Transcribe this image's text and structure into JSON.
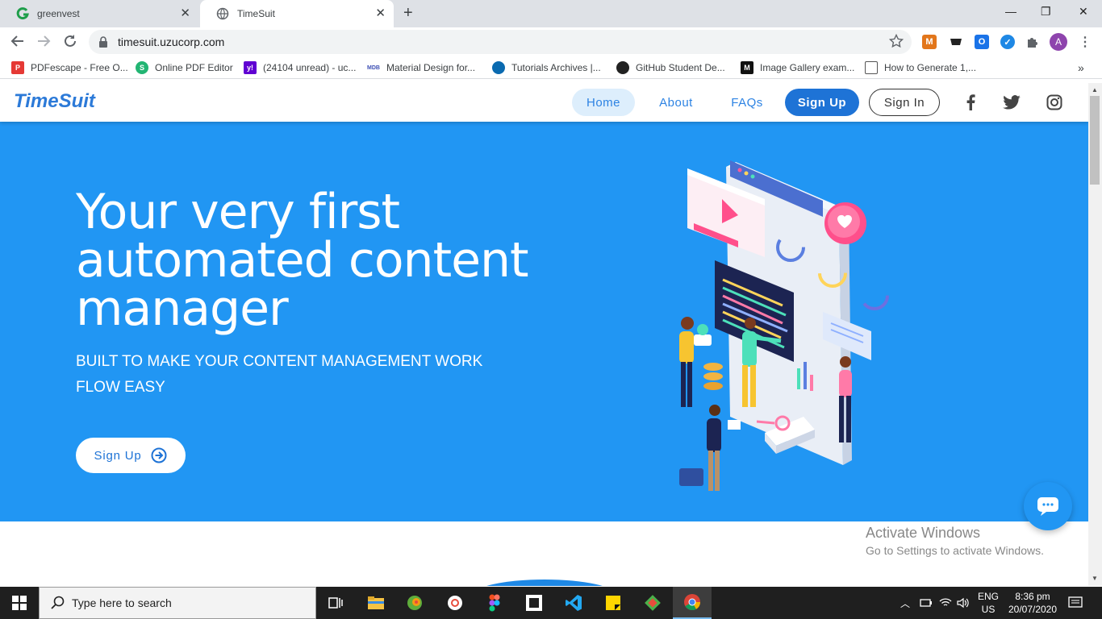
{
  "browser": {
    "tabs": [
      {
        "title": "greenvest"
      },
      {
        "title": "TimeSuit"
      }
    ],
    "url": "timesuit.uzucorp.com",
    "profile_initial": "A",
    "bookmarks": [
      {
        "label": "PDFescape - Free O..."
      },
      {
        "label": "Online PDF Editor"
      },
      {
        "label": "(24104 unread) - uc..."
      },
      {
        "label": "Material Design for..."
      },
      {
        "label": "Tutorials Archives |..."
      },
      {
        "label": "GitHub Student De..."
      },
      {
        "label": "Image Gallery exam..."
      },
      {
        "label": "How to Generate 1,..."
      }
    ]
  },
  "site": {
    "brand": "TimeSuit",
    "nav": {
      "home": "Home",
      "about": "About",
      "faqs": "FAQs",
      "signup": "Sign Up",
      "signin": "Sign In"
    },
    "hero": {
      "title": "Your very first automated content manager",
      "subtitle": "BUILT TO MAKE YOUR CONTENT MANAGEMENT WORK FLOW EASY",
      "cta": "Sign Up"
    },
    "colors": {
      "hero_bg": "#2196f3",
      "primary": "#1e73d6"
    }
  },
  "watermark": {
    "line1": "Activate Windows",
    "line2": "Go to Settings to activate Windows."
  },
  "taskbar": {
    "search_placeholder": "Type here to search",
    "lang_line1": "ENG",
    "lang_line2": "US",
    "time": "8:36 pm",
    "date": "20/07/2020"
  }
}
